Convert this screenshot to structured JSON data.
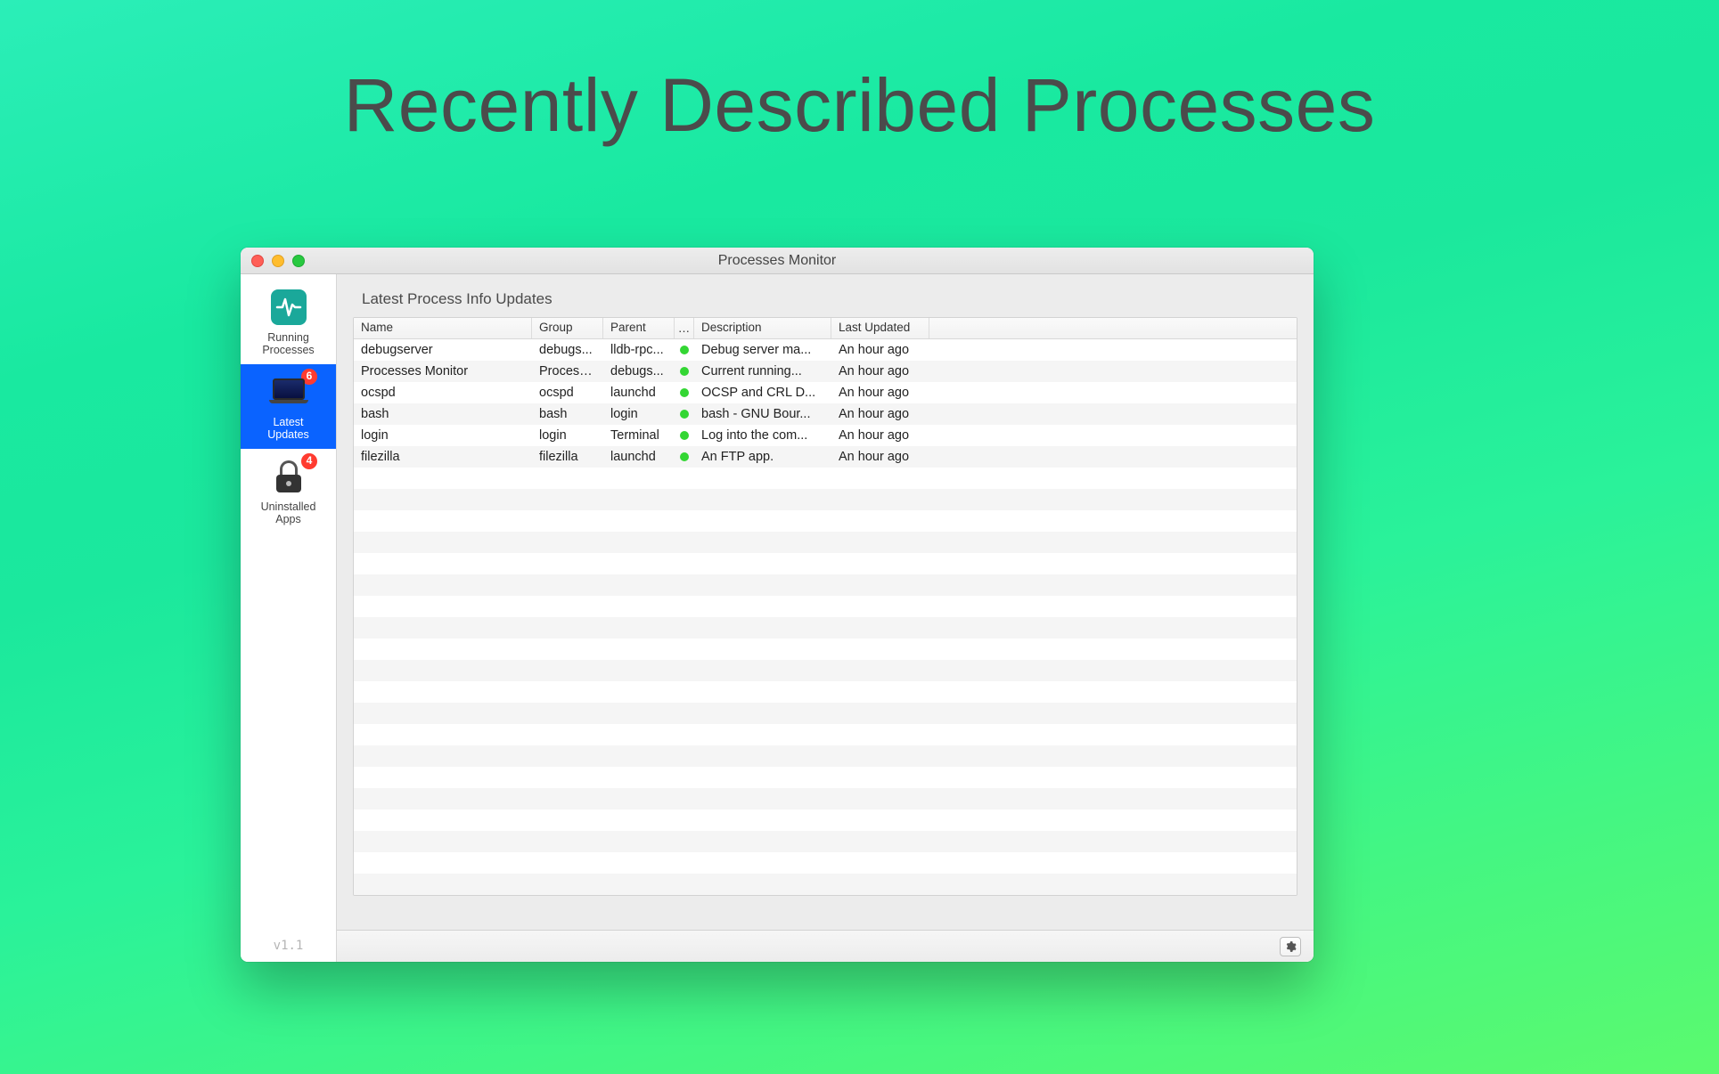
{
  "hero": {
    "title": "Recently Described Processes"
  },
  "window": {
    "title": "Processes Monitor"
  },
  "sidebar": {
    "items": [
      {
        "label_line1": "Running",
        "label_line2": "Processes",
        "badge": null
      },
      {
        "label_line1": "Latest",
        "label_line2": "Updates",
        "badge": "6"
      },
      {
        "label_line1": "Uninstalled",
        "label_line2": "Apps",
        "badge": "4"
      }
    ],
    "version": "v1.1"
  },
  "panel": {
    "title": "Latest Process Info Updates"
  },
  "table": {
    "headers": {
      "name": "Name",
      "group": "Group",
      "parent": "Parent",
      "dot": "…",
      "description": "Description",
      "last_updated": "Last Updated"
    },
    "rows": [
      {
        "name": "debugserver",
        "group": "debugs...",
        "parent": "lldb-rpc...",
        "status": "green",
        "description": "Debug server ma...",
        "last_updated": "An hour ago"
      },
      {
        "name": "Processes Monitor",
        "group": "Process...",
        "parent": "debugs...",
        "status": "green",
        "description": "Current running...",
        "last_updated": "An hour ago"
      },
      {
        "name": "ocspd",
        "group": "ocspd",
        "parent": "launchd",
        "status": "green",
        "description": "OCSP and CRL D...",
        "last_updated": "An hour ago"
      },
      {
        "name": "bash",
        "group": "bash",
        "parent": "login",
        "status": "green",
        "description": "bash - GNU Bour...",
        "last_updated": "An hour ago"
      },
      {
        "name": "login",
        "group": "login",
        "parent": "Terminal",
        "status": "green",
        "description": "Log into the com...",
        "last_updated": "An hour ago"
      },
      {
        "name": "filezilla",
        "group": "filezilla",
        "parent": "launchd",
        "status": "green",
        "description": "An FTP app.",
        "last_updated": "An hour ago"
      }
    ],
    "empty_rows": 20
  }
}
